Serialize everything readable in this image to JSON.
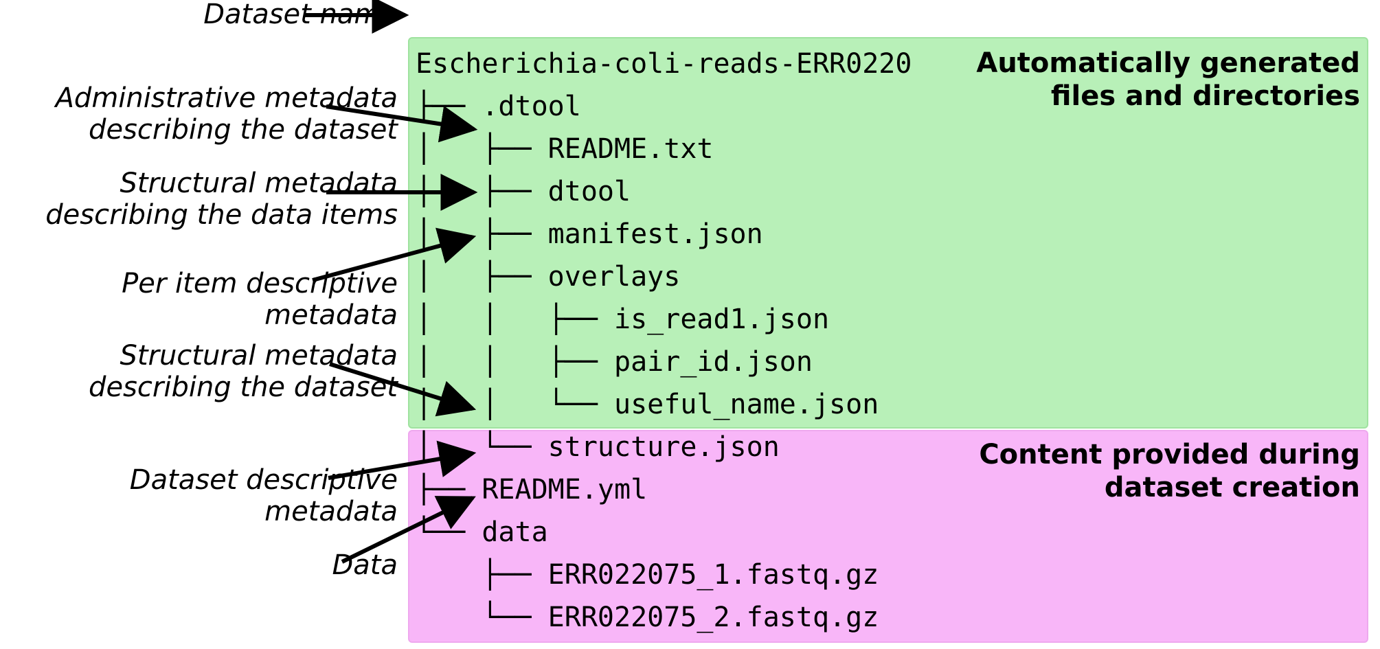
{
  "labels": {
    "dataset_name": "Dataset name",
    "admin_meta_l1": "Administrative metadata",
    "admin_meta_l2": "describing the dataset",
    "struct_items_l1": "Structural metadata",
    "struct_items_l2": "describing the data items",
    "per_item": "Per item descriptive metadata",
    "struct_ds_l1": "Structural metadata",
    "struct_ds_l2": "describing the dataset",
    "ds_desc": "Dataset descriptive metadata",
    "data": "Data"
  },
  "boxes": {
    "green_l1": "Automatically generated",
    "green_l2": "files and directories",
    "pink_l1": "Content provided during",
    "pink_l2": "dataset creation"
  },
  "tree": {
    "l0": "Escherichia-coli-reads-ERR0220",
    "l1": "├── .dtool",
    "l2": "│   ├── README.txt",
    "l3": "│   ├── dtool",
    "l4": "│   ├── manifest.json",
    "l5": "│   ├── overlays",
    "l6": "│   │   ├── is_read1.json",
    "l7": "│   │   ├── pair_id.json",
    "l8": "│   │   └── useful_name.json",
    "l9": "│   └── structure.json",
    "l10": "├── README.yml",
    "l11": "└── data",
    "l12": "    ├── ERR022075_1.fastq.gz",
    "l13": "    └── ERR022075_2.fastq.gz"
  }
}
